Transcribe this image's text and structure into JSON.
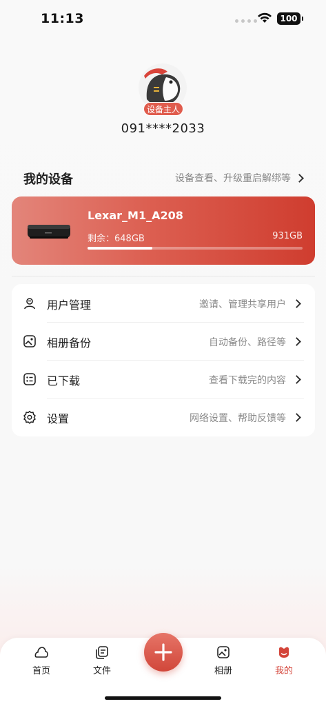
{
  "status_bar": {
    "time": "11:13",
    "battery": "100"
  },
  "profile": {
    "badge": "设备主人",
    "phone": "091****2033"
  },
  "my_devices": {
    "title": "我的设备",
    "link": "设备查看、升级重启解绑等",
    "device": {
      "name": "Lexar_M1_A208",
      "remaining": "剩余：648GB",
      "total": "931GB",
      "used_fraction": 0.3
    }
  },
  "menu": [
    {
      "icon": "user-manage-icon",
      "label": "用户管理",
      "hint": "邀请、管理共享用户"
    },
    {
      "icon": "album-backup-icon",
      "label": "相册备份",
      "hint": "自动备份、路径等"
    },
    {
      "icon": "downloaded-icon",
      "label": "已下载",
      "hint": "查看下载完的内容"
    },
    {
      "icon": "settings-gear-icon",
      "label": "设置",
      "hint": "网络设置、帮助反馈等"
    }
  ],
  "tabs": [
    {
      "icon": "home-icon",
      "label": "首页"
    },
    {
      "icon": "files-icon",
      "label": "文件"
    },
    {
      "icon": "album-icon",
      "label": "相册"
    },
    {
      "icon": "profile-icon",
      "label": "我的",
      "active": true
    }
  ],
  "colors": {
    "accent": "#d4453a",
    "card_start": "#e3857a",
    "card_end": "#cf3d2f"
  }
}
